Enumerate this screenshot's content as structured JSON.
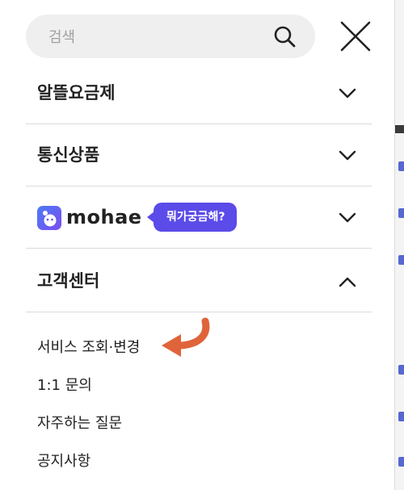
{
  "search": {
    "placeholder": "검색"
  },
  "menu": {
    "items": [
      {
        "label": "알뜰요금제",
        "state": "collapsed"
      },
      {
        "label": "통신상품",
        "state": "collapsed"
      },
      {
        "brand": "mohae",
        "bubble": "뭐가궁금해?",
        "state": "collapsed"
      },
      {
        "label": "고객센터",
        "state": "expanded"
      }
    ]
  },
  "customer_center": {
    "subitems": [
      "서비스 조회·변경",
      "1:1 문의",
      "자주하는 질문",
      "공지사항"
    ]
  },
  "colors": {
    "brand_purple": "#5b4be8",
    "annotation_arrow": "#e0643a",
    "search_bg": "#efefef",
    "divider": "#dadada"
  },
  "icons": [
    "search-icon",
    "close-icon",
    "chevron-down-icon",
    "chevron-up-icon",
    "mohae-logo-icon",
    "curved-arrow-icon"
  ]
}
